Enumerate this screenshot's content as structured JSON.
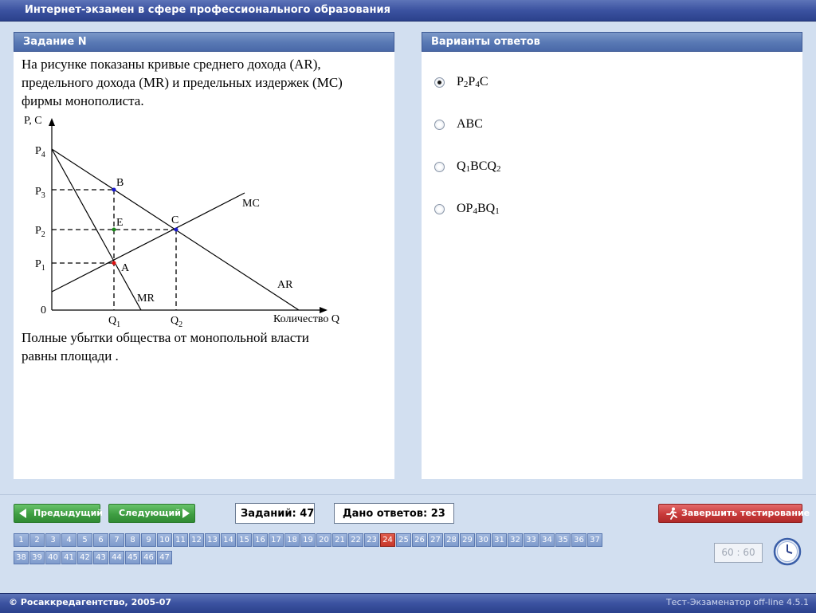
{
  "window": {
    "title": "Интернет-экзамен в сфере профессионального образования"
  },
  "task": {
    "header": "Задание N",
    "question_line1": "На рисунке показаны кривые среднего дохода (AR),",
    "question_line2": "предельного дохода (MR) и предельных издержек (MC)",
    "question_line3": "фирмы монополиста.",
    "closing_line1": "Полные убытки общества от монопольной власти",
    "closing_line2": "равны площади .",
    "graph": {
      "y_axis_label": "P, C",
      "x_axis_label": "Количество Q",
      "origin": "0",
      "price_labels": [
        {
          "main": "P",
          "sub": "4"
        },
        {
          "main": "P",
          "sub": "3"
        },
        {
          "main": "P",
          "sub": "2"
        },
        {
          "main": "P",
          "sub": "1"
        }
      ],
      "quantity_labels": [
        {
          "main": "Q",
          "sub": "1"
        },
        {
          "main": "Q",
          "sub": "2"
        }
      ],
      "curve_labels": {
        "mc": "MC",
        "ar": "AR",
        "mr": "MR"
      },
      "points": {
        "a": {
          "label": "A",
          "color": "#e01010"
        },
        "b": {
          "label": "B",
          "color": "#1a1ad0"
        },
        "c": {
          "label": "C",
          "color": "#1a1ad0"
        },
        "e": {
          "label": "E",
          "color": "#1a8a1a"
        }
      }
    }
  },
  "answers": {
    "header": "Варианты ответов",
    "options": [
      {
        "parts": [
          {
            "t": "P"
          },
          {
            "s": "2"
          },
          {
            "t": "P"
          },
          {
            "s": "4"
          },
          {
            "t": "C"
          }
        ],
        "selected": true
      },
      {
        "parts": [
          {
            "t": "ABC"
          }
        ],
        "selected": false
      },
      {
        "parts": [
          {
            "t": "Q"
          },
          {
            "s": "1"
          },
          {
            "t": "BCQ"
          },
          {
            "s": "2"
          }
        ],
        "selected": false
      },
      {
        "parts": [
          {
            "t": "OP"
          },
          {
            "s": "4"
          },
          {
            "t": "BQ"
          },
          {
            "s": "1"
          }
        ],
        "selected": false
      }
    ]
  },
  "navigation": {
    "prev_label": "Предыдущий",
    "next_label": "Следующий",
    "tasks_count_label": "Заданий: 47",
    "answered_label": "Дано ответов: 23",
    "finish_label": "Завершить тестирование",
    "current_question": 24,
    "question_numbers": [
      "1",
      "2",
      "3",
      "4",
      "5",
      "6",
      "7",
      "8",
      "9",
      "10",
      "11",
      "12",
      "13",
      "14",
      "15",
      "16",
      "17",
      "18",
      "19",
      "20",
      "21",
      "22",
      "23",
      "24",
      "25",
      "26",
      "27",
      "28",
      "29",
      "30",
      "31",
      "32",
      "33",
      "34",
      "35",
      "36",
      "37",
      "38",
      "39",
      "40",
      "41",
      "42",
      "43",
      "44",
      "45",
      "46",
      "47"
    ],
    "timer": "60 : 60"
  },
  "footer": {
    "copyright": "© Росаккредагентство, 2005-07",
    "version": "Тест-Экзаменатор off-line 4.5.1"
  },
  "colors": {
    "accent": "#3b52a0",
    "nav_green": "#3f9e42",
    "finish_red": "#c83a3a",
    "current_q": "#c8372a"
  }
}
